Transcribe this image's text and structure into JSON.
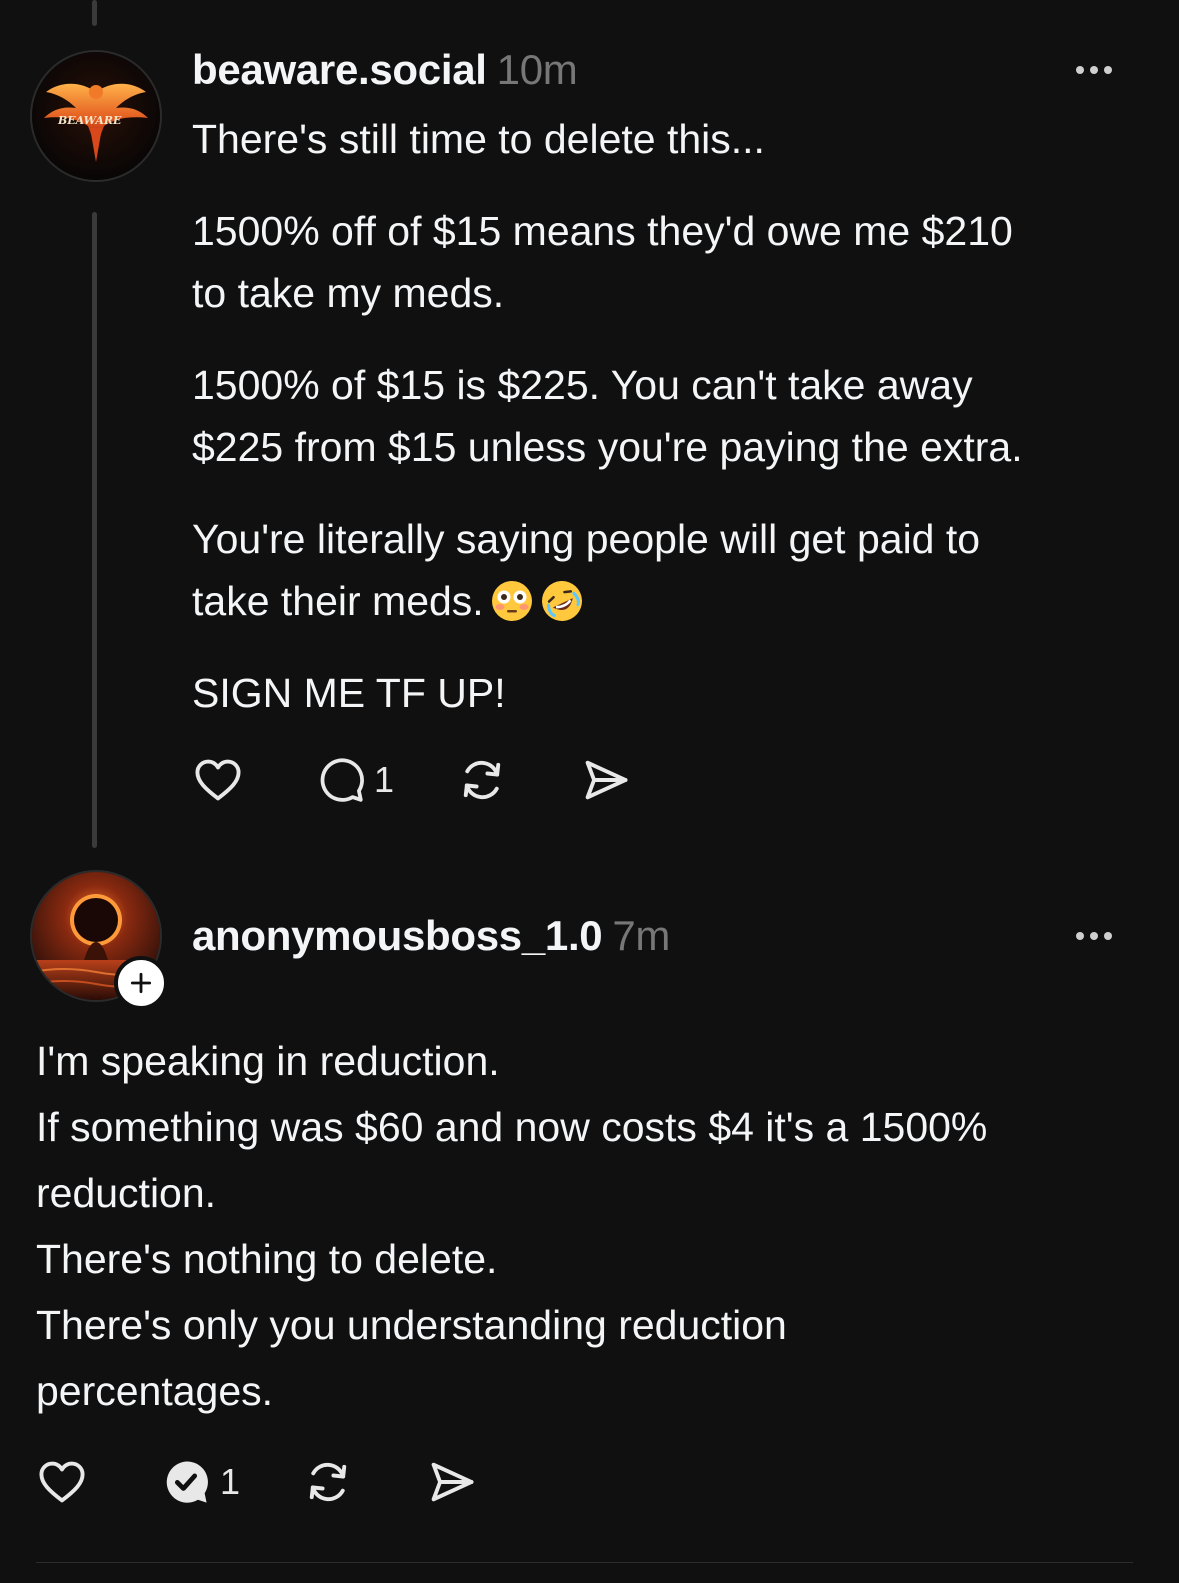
{
  "colors": {
    "background": "#101010",
    "text": "#f3f5f7",
    "muted": "#777777",
    "thread_line": "#3a3a3a"
  },
  "post1": {
    "username": "beaware.social",
    "time": "10m",
    "avatar_logo_text": "BEAWARE",
    "paragraphs": [
      [
        "There's still time to delete this..."
      ],
      [
        "1500% off of $15 means they'd owe me $210",
        "to take my meds."
      ],
      [
        "1500% of $15 is $225. You can't take away",
        "$225 from $15 unless you're paying the extra."
      ],
      [
        "You're literally saying people will get paid to",
        "take their meds."
      ],
      [
        "SIGN ME TF UP!"
      ]
    ],
    "emojis": [
      "flushed-face-emoji",
      "rolling-on-floor-laughing-emoji"
    ],
    "reply_count": "1",
    "icons": [
      "heart-icon",
      "comment-icon",
      "repost-icon",
      "share-icon"
    ]
  },
  "post2": {
    "username": "anonymousboss_1.0",
    "time": "7m",
    "lines": [
      "I'm speaking in reduction.",
      "If something was $60 and now costs $4 it's a 1500%",
      "reduction.",
      "There's nothing to delete.",
      "There's only you understanding reduction",
      "percentages."
    ],
    "reply_count": "1",
    "icons": [
      "heart-icon",
      "replied-check-icon",
      "repost-icon",
      "share-icon"
    ]
  }
}
